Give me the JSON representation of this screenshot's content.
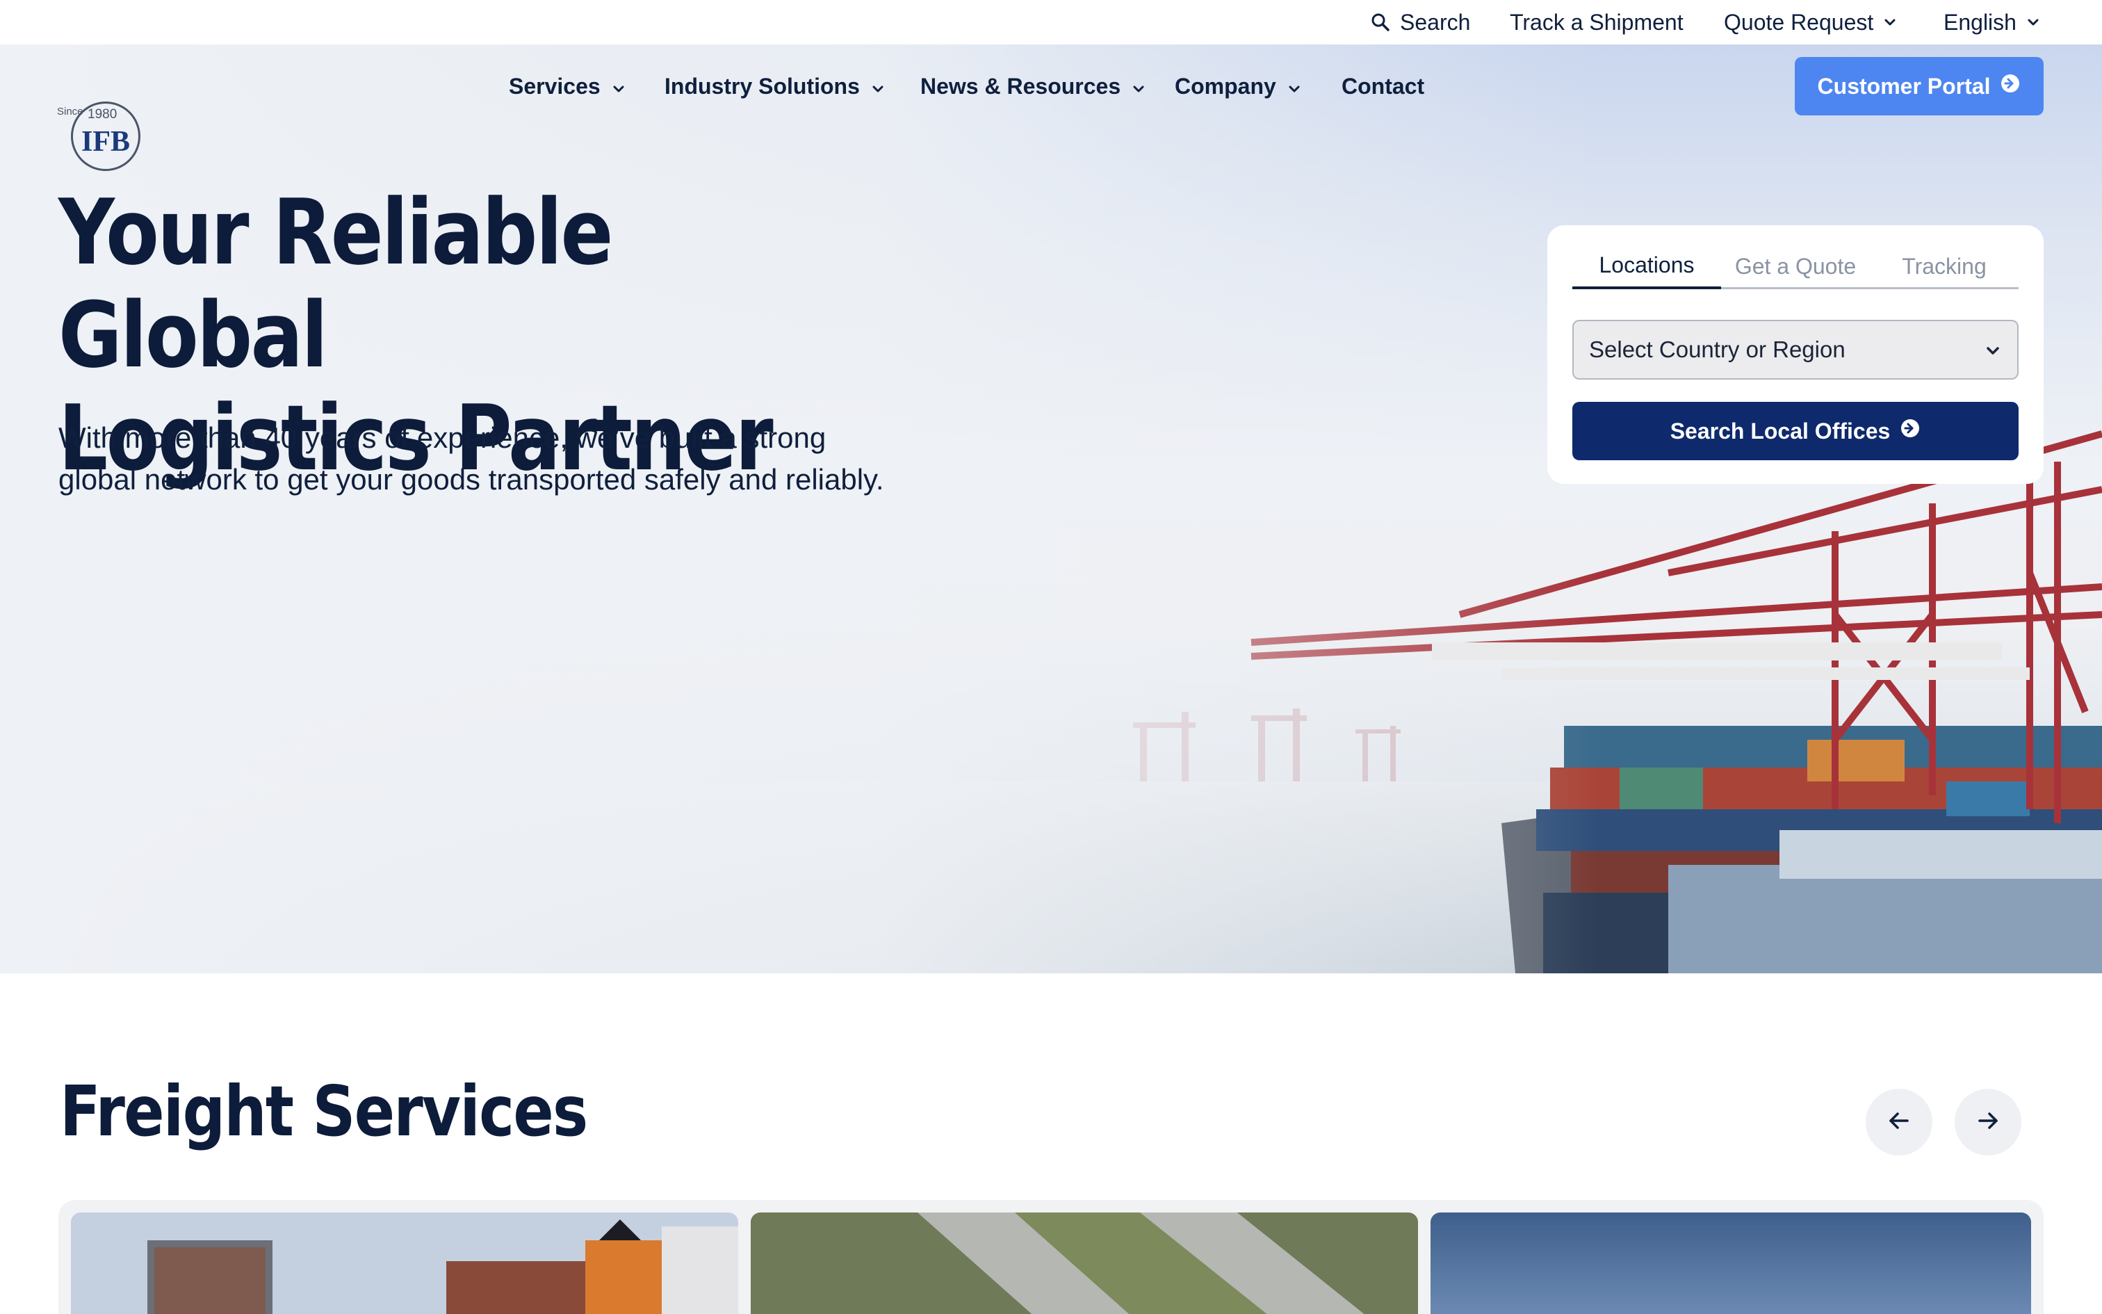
{
  "topbar": {
    "search_label": "Search",
    "track_label": "Track a Shipment",
    "quote_label": "Quote Request",
    "language_label": "English"
  },
  "logo": {
    "since": "Since",
    "year": "1980",
    "name": "IFB"
  },
  "nav": {
    "items": [
      {
        "label": "Services"
      },
      {
        "label": "Industry Solutions"
      },
      {
        "label": "News & Resources"
      },
      {
        "label": "Company"
      },
      {
        "label": "Contact"
      }
    ],
    "portal_label": "Customer Portal"
  },
  "hero": {
    "title_line1": "Your Reliable Global",
    "title_line2": "Logistics Partner",
    "subtitle": "With more than 40 years of experience, we’ve built a strong global network to get your goods transported safely and reliably."
  },
  "widget": {
    "tabs": [
      {
        "label": "Locations"
      },
      {
        "label": "Get a Quote"
      },
      {
        "label": "Tracking"
      }
    ],
    "select_value": "Select Country or Region",
    "button_label": "Search Local Offices"
  },
  "freight": {
    "title": "Freight Services"
  },
  "colors": {
    "navy": "#0c1c3a",
    "portal_blue": "#4d86f0",
    "button_navy": "#0e2a6d"
  },
  "icons": [
    "search-icon",
    "chevron-down-icon",
    "arrow-circle-right-icon",
    "arrow-left-icon",
    "arrow-right-icon"
  ]
}
